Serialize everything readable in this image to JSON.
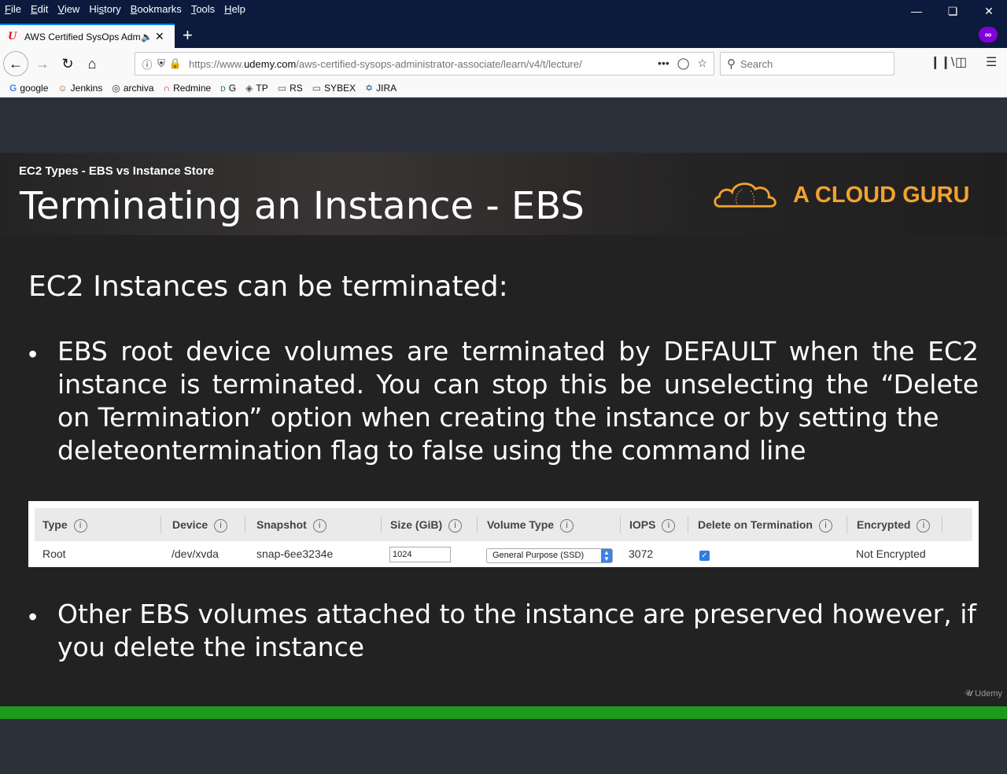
{
  "menubar": {
    "items": [
      {
        "key": "F",
        "rest": "ile"
      },
      {
        "key": "E",
        "rest": "dit"
      },
      {
        "key": "V",
        "rest": "iew"
      },
      {
        "pre": "Hi",
        "key": "s",
        "rest": "tory"
      },
      {
        "key": "B",
        "rest": "ookmarks"
      },
      {
        "key": "T",
        "rest": "ools"
      },
      {
        "key": "H",
        "rest": "elp"
      }
    ]
  },
  "tab": {
    "title": "AWS Certified SysOps Admini",
    "favicon": "udemy-icon"
  },
  "navbar": {
    "url_prefix": "https://www.",
    "url_domain": "udemy.com",
    "url_rest": "/aws-certified-sysops-administrator-associate/learn/v4/t/lecture/",
    "search_placeholder": "Search"
  },
  "bookmarks": [
    {
      "label": "google",
      "icon": "google-icon"
    },
    {
      "label": "Jenkins",
      "icon": "jenkins-icon"
    },
    {
      "label": "archiva",
      "icon": "globe-icon"
    },
    {
      "label": "Redmine",
      "icon": "redmine-icon"
    },
    {
      "label": "G",
      "icon": "dg-icon"
    },
    {
      "label": "TP",
      "icon": "tp-icon"
    },
    {
      "label": "RS",
      "icon": "folder-icon"
    },
    {
      "label": "SYBEX",
      "icon": "folder-icon"
    },
    {
      "label": "JIRA",
      "icon": "jira-icon"
    }
  ],
  "slide": {
    "subtitle": "EC2 Types - EBS vs Instance Store",
    "title": "Terminating an Instance - EBS",
    "brand": "A CLOUD GURU",
    "heading": "EC2 Instances can be terminated:",
    "bullet1_main": "EBS root device volumes are terminated by DEFAULT when the EC2 instance is terminated. You can stop this be unselecting the “Delete on Termination” option when creating the instance or by setting the",
    "bullet1_last": "deleteontermination flag to false using the command line",
    "bullet2_main": "Other EBS volumes attached to the instance are preserved however, if",
    "bullet2_last": "you delete the instance",
    "watermark": "Udemy"
  },
  "table": {
    "headers": [
      "Type",
      "Device",
      "Snapshot",
      "Size (GiB)",
      "Volume Type",
      "IOPS",
      "Delete on Termination",
      "Encrypted"
    ],
    "row": {
      "type": "Root",
      "device": "/dev/xvda",
      "snapshot": "snap-6ee3234e",
      "size": "1024",
      "volume_type": "General Purpose (SSD)",
      "iops": "3072",
      "delete_on_termination": true,
      "encrypted": "Not Encrypted"
    }
  },
  "colors": {
    "brand_orange": "#f2a230",
    "progress_green": "#1c9a1c",
    "checkbox_blue": "#2f7de1"
  }
}
